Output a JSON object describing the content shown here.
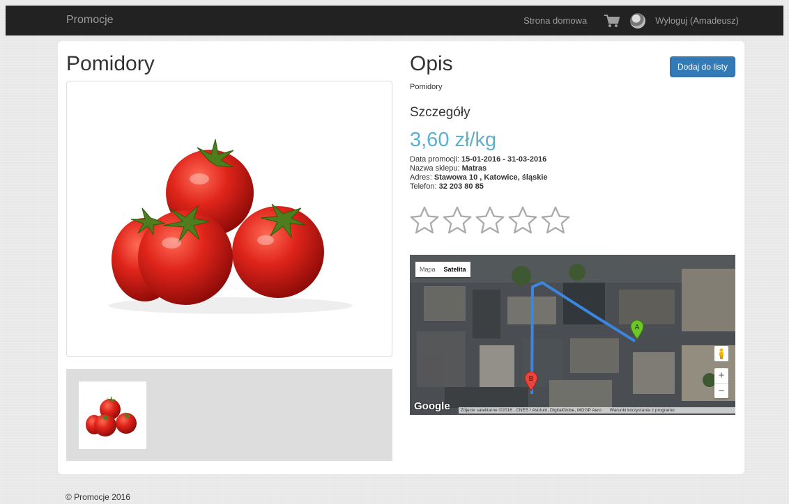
{
  "navbar": {
    "brand": "Promocje",
    "home_link": "Strona domowa",
    "logout_link": "Wyloguj (Amadeusz)"
  },
  "product": {
    "title": "Pomidory"
  },
  "details": {
    "heading": "Opis",
    "add_button": "Dodaj do listy",
    "description": "Pomidory",
    "subheading": "Szczegóły",
    "price": "3,60 zł/kg",
    "promo_label": "Data promocji:",
    "promo_value": "15-01-2016 - 31-03-2016",
    "shop_label": "Nazwa sklepu:",
    "shop_value": "Matras",
    "address_label": "Adres:",
    "address_value": "Stawowa 10 , Katowice, śląskie",
    "phone_label": "Telefon:",
    "phone_value": "32 203 80 85",
    "rating": 0,
    "rating_max": 5
  },
  "map": {
    "type_map": "Mapa",
    "type_satellite": "Satelita",
    "marker_a": "A",
    "marker_b": "B",
    "logo": "Google",
    "zoom_in": "+",
    "zoom_out": "−",
    "attribution": "Zdjęcie satelitarne ©2016 , CNES / Astrium, DigitalGlobe, MGGP Aero",
    "terms": "Warunki korzystania z programu"
  },
  "footer": {
    "copyright": "© Promocje 2016"
  },
  "colors": {
    "accent": "#337ab7",
    "price": "#5bb0d0",
    "navbar": "#222222",
    "route": "#3a86e0"
  },
  "icons": [
    "cart-icon",
    "avatar",
    "star-outline-icon",
    "pegman-icon",
    "map-marker-a-icon",
    "map-marker-b-icon"
  ]
}
